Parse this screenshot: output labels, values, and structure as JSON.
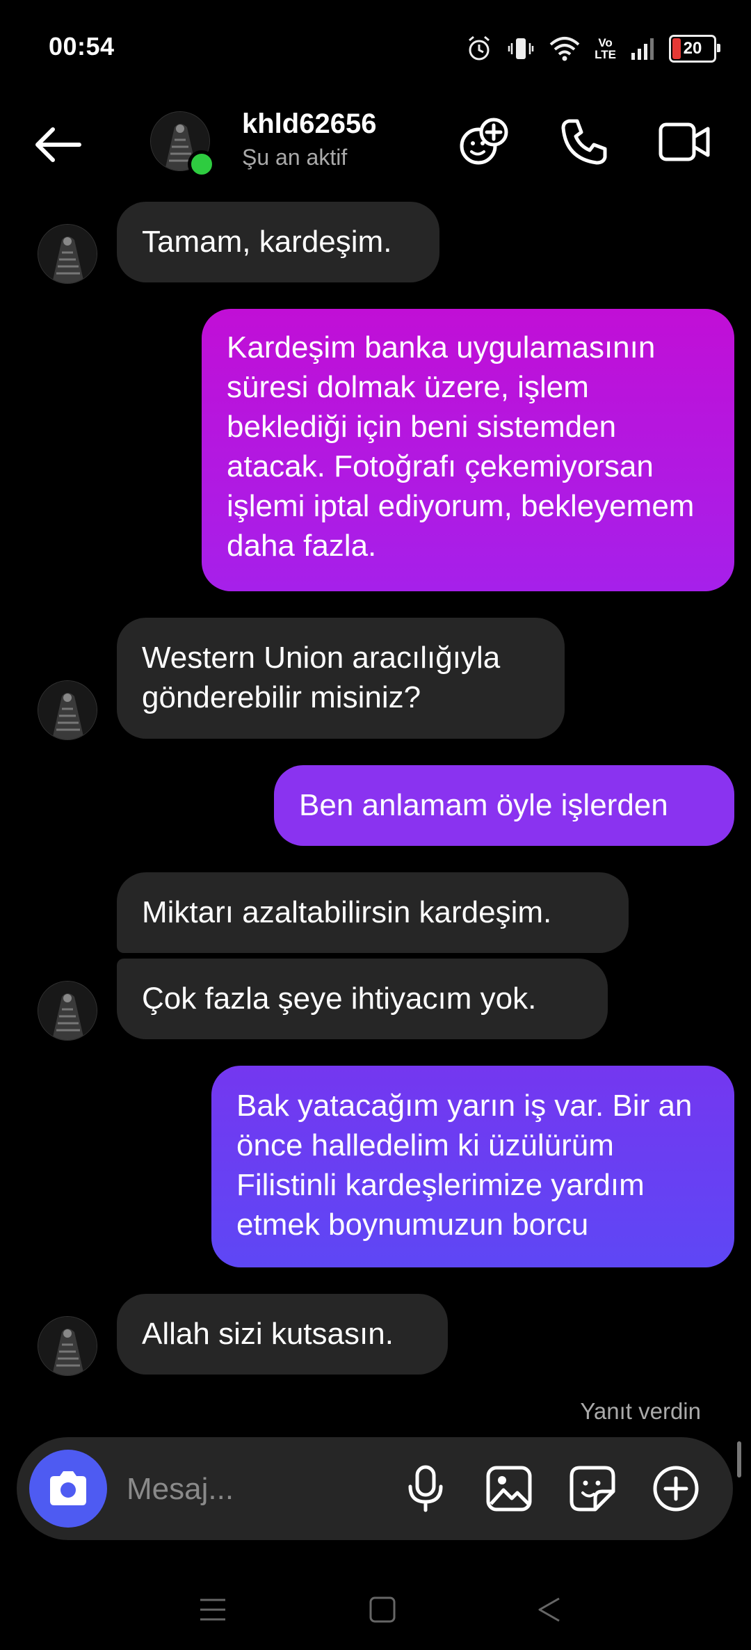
{
  "status_bar": {
    "time": "00:54",
    "battery": "20",
    "network": "Vo LTE"
  },
  "header": {
    "username": "khld62656",
    "status": "Şu an aktif"
  },
  "colors": {
    "accent": "#4e5bf2",
    "online": "#2ecc40",
    "incoming_bubble": "#262626",
    "outgoing_top": "#c10fd6",
    "outgoing_bottom": "#5e47f5"
  },
  "messages": [
    {
      "direction": "in",
      "text": "Tamam, kardeşim."
    },
    {
      "direction": "out",
      "text": "Kardeşim banka uygulamasının süresi dolmak üzere, işlem beklediği için beni sistemden atacak. Fotoğrafı çekemiyorsan işlemi iptal ediyorum, bekleyemem daha fazla."
    },
    {
      "direction": "in",
      "text": "Western Union aracılığıyla gönderebilir misiniz?"
    },
    {
      "direction": "out",
      "text": "Ben anlamam öyle işlerden"
    },
    {
      "direction": "in",
      "text": "Miktarı azaltabilirsin kardeşim."
    },
    {
      "direction": "in",
      "text": "Çok fazla şeye ihtiyacım yok."
    },
    {
      "direction": "out",
      "text": "Bak yatacağım yarın iş var. Bir an önce halledelim ki üzülürüm Filistinli kardeşlerimize yardım etmek boynumuzun borcu"
    },
    {
      "direction": "in",
      "text": "Allah sizi kutsasın."
    }
  ],
  "reply_status": "Yanıt verdin",
  "composer": {
    "placeholder": "Mesaj..."
  },
  "icons": {
    "back": "arrow-left-icon",
    "effects": "sticker-plus-icon",
    "call": "phone-icon",
    "video": "video-camera-icon",
    "camera": "camera-icon",
    "mic": "microphone-icon",
    "gallery": "image-icon",
    "sticker": "sticker-icon",
    "more": "plus-circle-icon"
  }
}
